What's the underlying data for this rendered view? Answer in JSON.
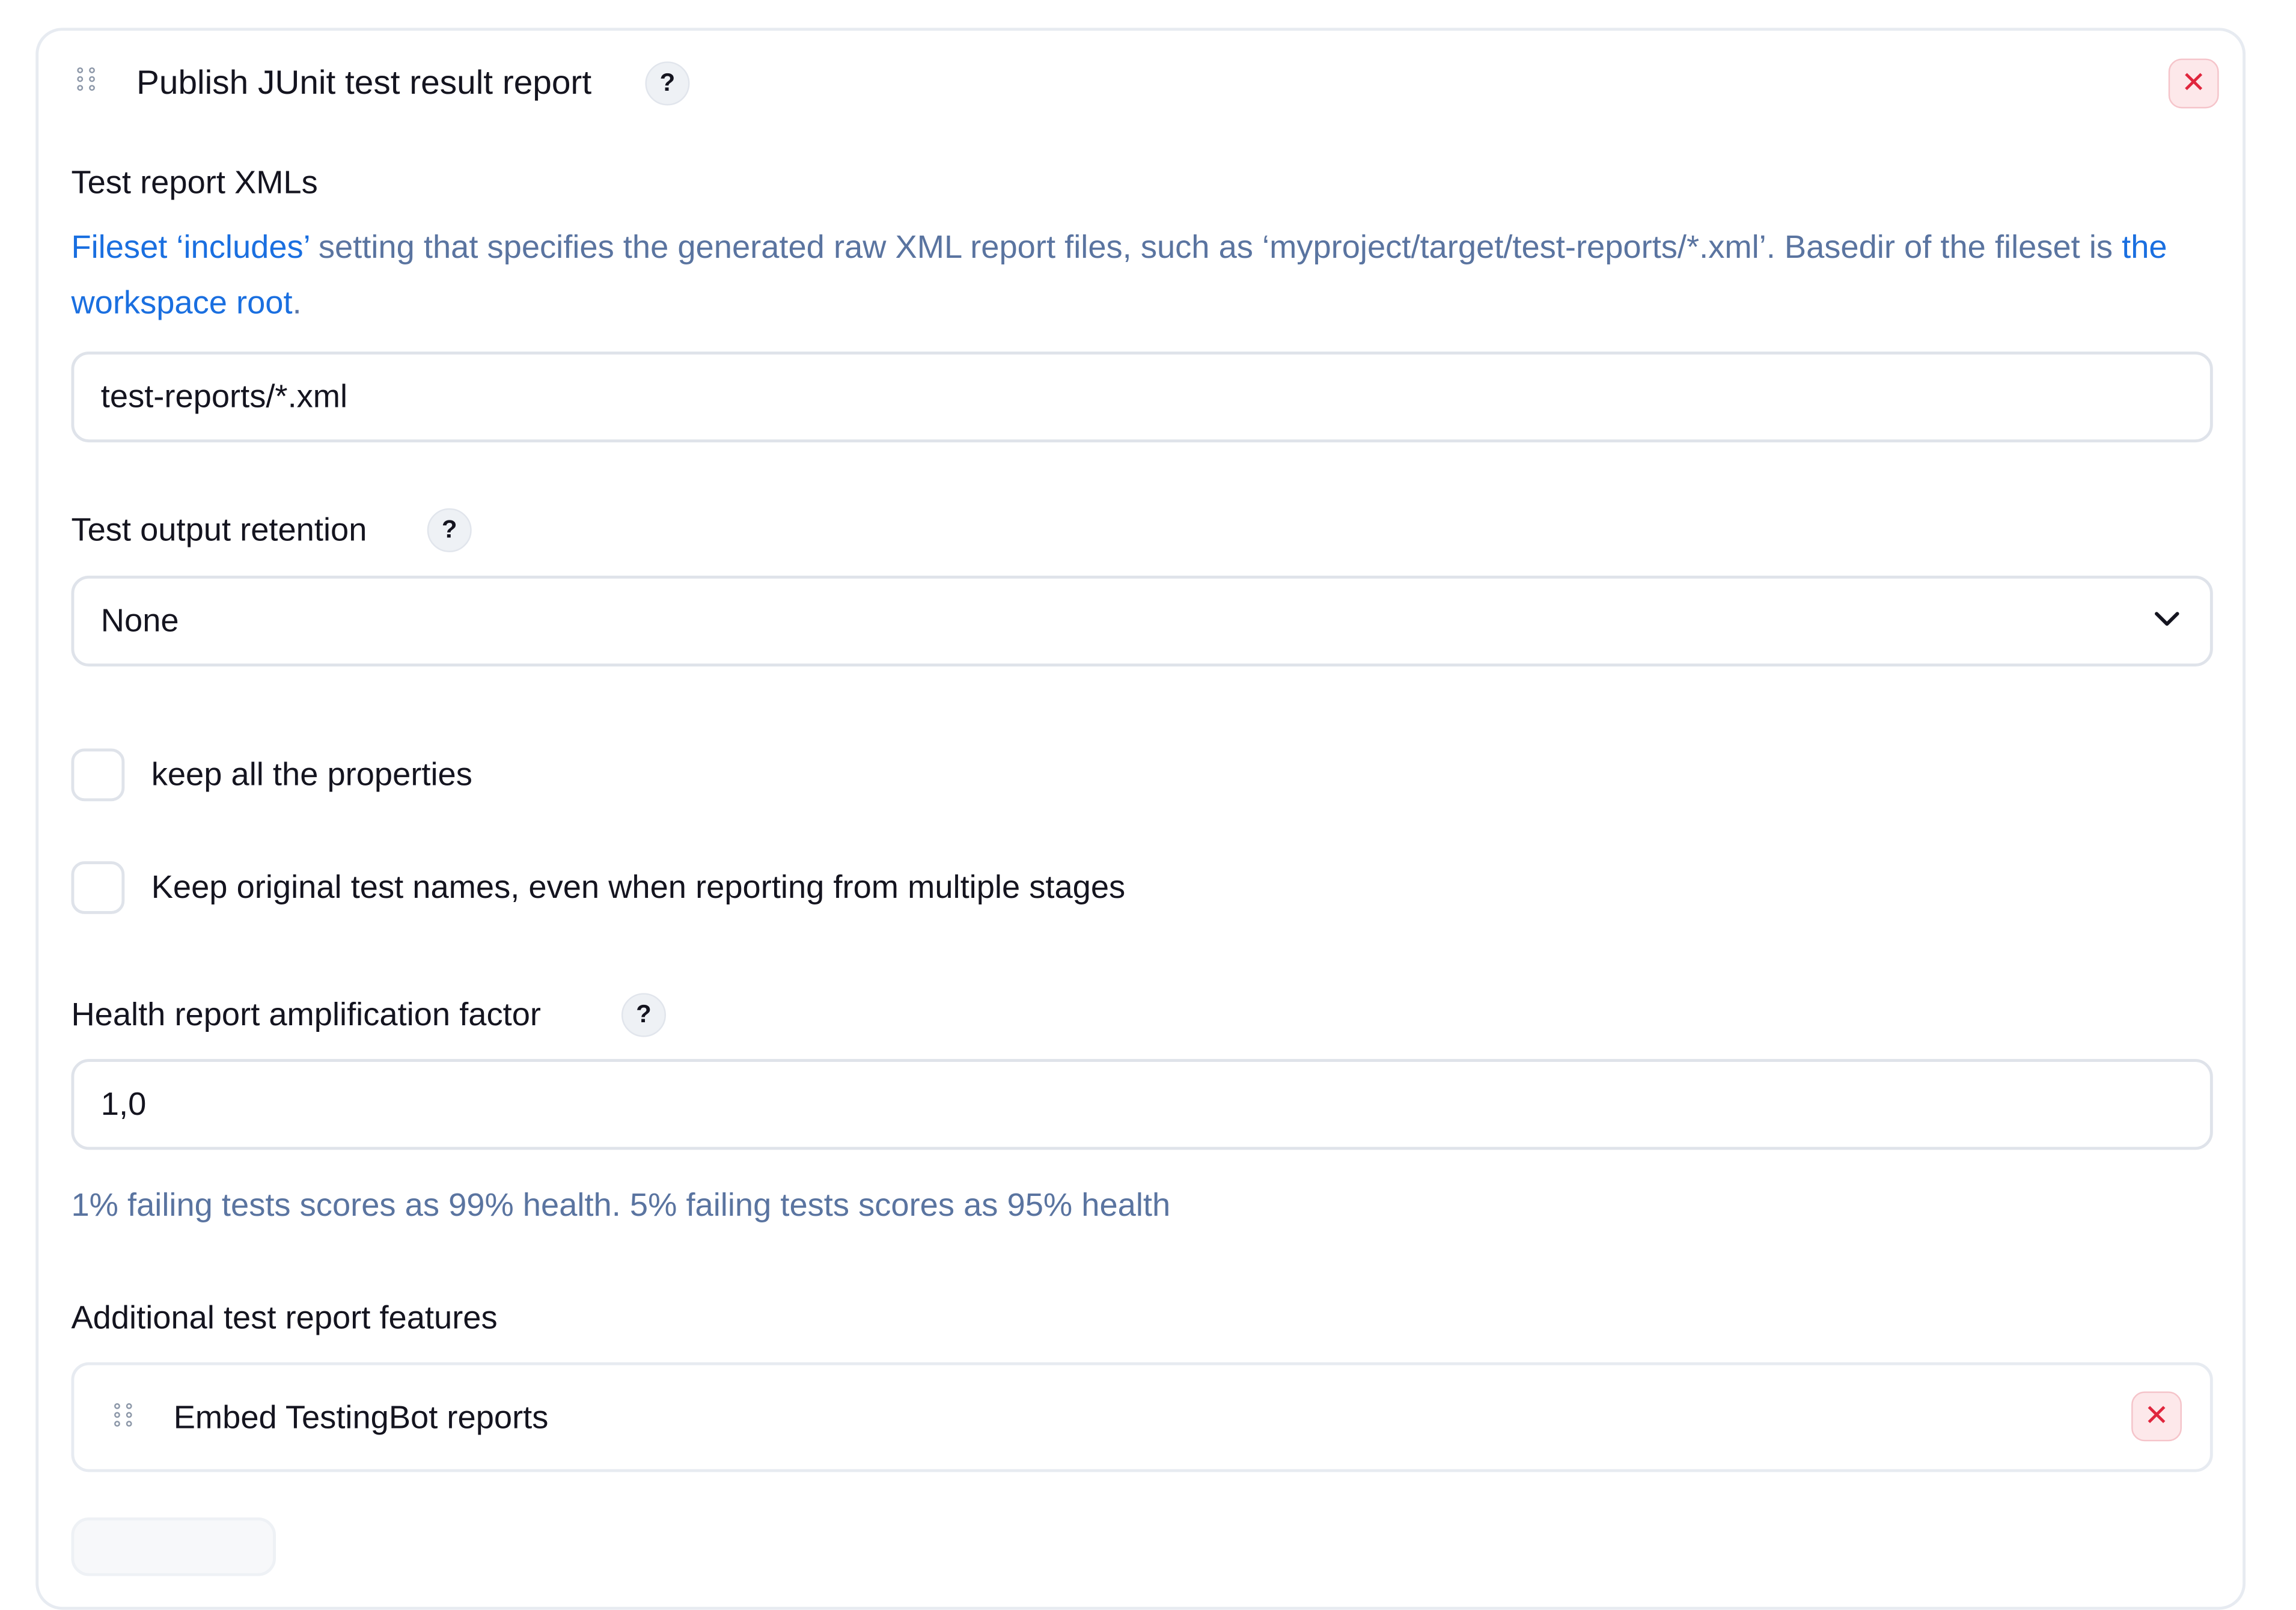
{
  "section": {
    "title": "Publish JUnit test result report",
    "help": "?",
    "close": "✕"
  },
  "test_report_xmls": {
    "label": "Test report XMLs",
    "desc_link1": "Fileset ‘includes’",
    "desc_text1": " setting that specifies the generated raw XML report files, such as ‘myproject/target/test-reports/*.xml’. Basedir of the fileset is ",
    "desc_link2": "the workspace root",
    "desc_text2": ".",
    "value": "test-reports/*.xml"
  },
  "test_output_retention": {
    "label": "Test output retention",
    "help": "?",
    "selected": "None"
  },
  "checkboxes": {
    "keep_properties": {
      "label": "keep all the properties",
      "checked": false
    },
    "keep_names": {
      "label": "Keep original test names, even when reporting from multiple stages",
      "checked": false
    }
  },
  "health": {
    "label": "Health report amplification factor",
    "help": "?",
    "value": "1,0",
    "hint": "1% failing tests scores as 99% health. 5% failing tests scores as 95% health"
  },
  "additional": {
    "label": "Additional test report features",
    "items": [
      {
        "label": "Embed TestingBot reports",
        "close": "✕"
      }
    ]
  }
}
